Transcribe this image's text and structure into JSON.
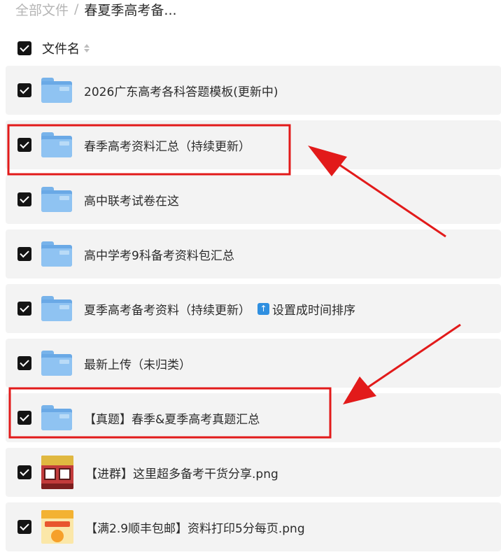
{
  "breadcrumb": {
    "root": "全部文件",
    "separator": "/",
    "current": "春夏季高考备..."
  },
  "list_header": {
    "column_title": "文件名",
    "select_all_checked": true
  },
  "files": [
    {
      "name": "2026广东高考各科答题模板(更新中)",
      "type": "folder",
      "checked": true
    },
    {
      "name": "春季高考资料汇总（持续更新）",
      "type": "folder",
      "checked": true
    },
    {
      "name": "高中联考试卷在这",
      "type": "folder",
      "checked": true
    },
    {
      "name": "高中学考9科备考资料包汇总",
      "type": "folder",
      "checked": true
    },
    {
      "name": "夏季高考备考资料（持续更新）",
      "type": "folder",
      "checked": true,
      "extra_icon": "up-arrow-icon",
      "extra_text": "设置成时间排序"
    },
    {
      "name": "最新上传（未归类）",
      "type": "folder",
      "checked": true
    },
    {
      "name": "【真题】春季&夏季高考真题汇总",
      "type": "folder",
      "checked": true
    },
    {
      "name": "【进群】这里超多备考干货分享.png",
      "type": "image",
      "checked": true
    },
    {
      "name": "【满2.9顺丰包邮】资料打印5分每页.png",
      "type": "image",
      "checked": true
    }
  ],
  "colors": {
    "highlight": "#e21a1a",
    "folder": "#8fc3f2",
    "row_background": "#f3f3f3"
  },
  "annotations": {
    "highlighted_rows": [
      1,
      6
    ],
    "arrows": 2
  }
}
